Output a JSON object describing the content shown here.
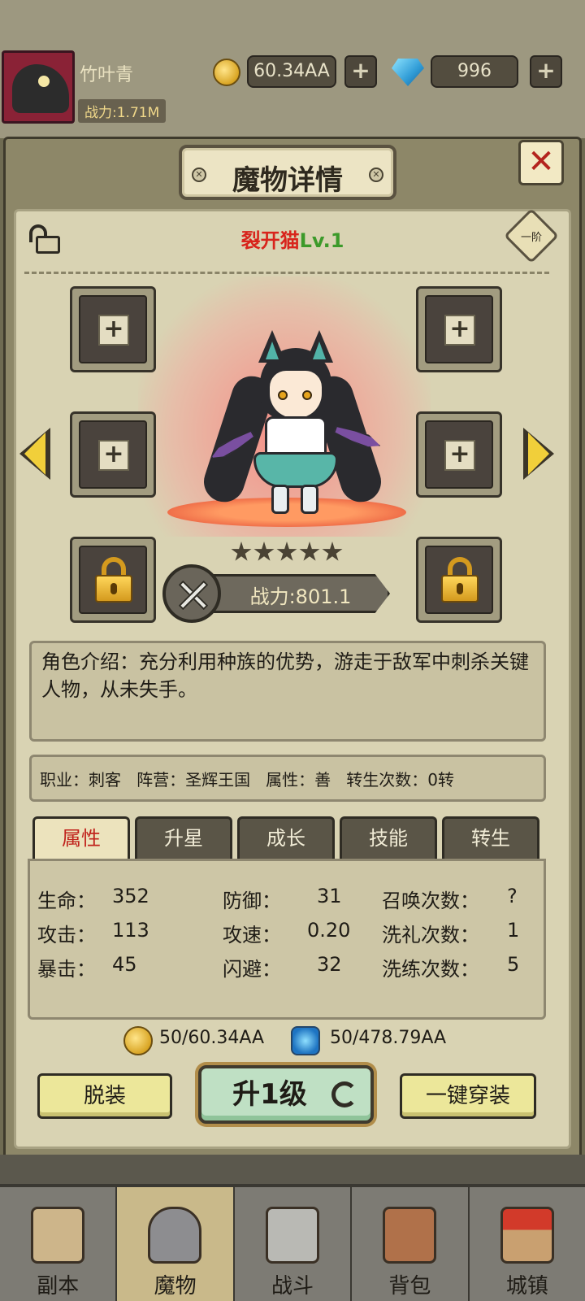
{
  "player": {
    "name": "竹叶青",
    "power": "战力:1.71M"
  },
  "resources": {
    "gold": "60.34AA",
    "gems": "996",
    "plus": "+"
  },
  "panel": {
    "title": "魔物详情",
    "close": "✕",
    "bolt": "✕"
  },
  "monster": {
    "name": "裂开猫",
    "level": "Lv.1",
    "rank": "一阶",
    "stars": 5,
    "power": "战力:801.1",
    "description": "角色介绍：充分利用种族的优势，游走于敌军中刺杀关键人物，从未失手。",
    "info": "职业：刺客   阵营：圣辉王国   属性：善   转生次数：0转"
  },
  "equip_slots": {
    "plus": "+"
  },
  "tabs": [
    "属性",
    "升星",
    "成长",
    "技能",
    "转生"
  ],
  "attributes": {
    "col1": [
      {
        "label": "生命：",
        "value": "352"
      },
      {
        "label": "攻击：",
        "value": "113"
      },
      {
        "label": "暴击：",
        "value": "45"
      }
    ],
    "col2": [
      {
        "label": "防御：",
        "value": "31"
      },
      {
        "label": "攻速：",
        "value": "0.20"
      },
      {
        "label": "闪避：",
        "value": "32"
      }
    ],
    "col3": [
      {
        "label": "召唤次数：",
        "value": "?"
      },
      {
        "label": "洗礼次数：",
        "value": "1"
      },
      {
        "label": "洗练次数：",
        "value": "5"
      }
    ]
  },
  "cost": {
    "gold": "50/60.34AA",
    "orb": "50/478.79AA"
  },
  "buttons": {
    "unequip": "脱装",
    "level_up": "升1级",
    "equip_all": "一键穿装"
  },
  "nav": [
    "副本",
    "魔物",
    "战斗",
    "背包",
    "城镇"
  ],
  "colors": {
    "name_red": "#d8241c",
    "level_green": "#3c9a2a",
    "tab_active": "#ece3bd",
    "button_yellow": "#ece79a"
  }
}
